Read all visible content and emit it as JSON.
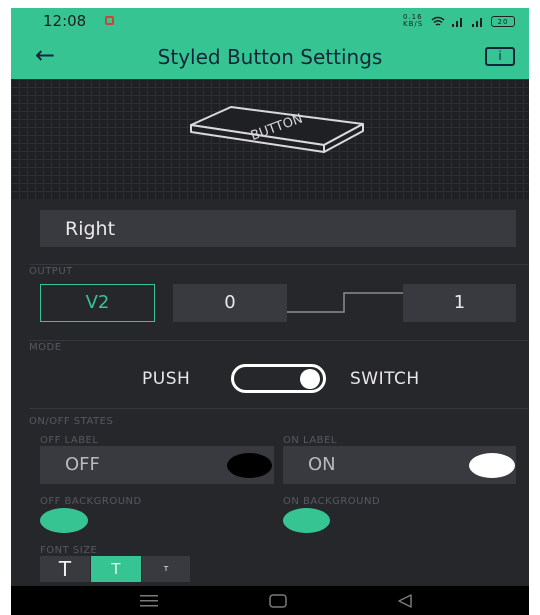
{
  "status_bar": {
    "time": "12:08",
    "right_text": "0.16 KB/S",
    "battery": "20"
  },
  "header": {
    "title": "Styled Button Settings"
  },
  "preview": {
    "button_text": "BUTTON"
  },
  "name_field": {
    "value": "Right"
  },
  "output": {
    "section_label": "OUTPUT",
    "pin": "V2",
    "min_value": "0",
    "max_value": "1"
  },
  "mode": {
    "section_label": "MODE",
    "push_label": "PUSH",
    "switch_label": "SWITCH",
    "selected": "SWITCH"
  },
  "states": {
    "section_label": "ON/OFF STATES",
    "off_label_title": "OFF LABEL",
    "off_label_value": "OFF",
    "off_label_color": "#000000",
    "on_label_title": "ON LABEL",
    "on_label_value": "ON",
    "on_label_color": "#ffffff",
    "off_background_title": "OFF BACKGROUND",
    "off_background_color": "#36c592",
    "on_background_title": "ON BACKGROUND",
    "on_background_color": "#36c592"
  },
  "font_size": {
    "section_label": "FONT SIZE",
    "options": [
      "T",
      "T",
      "T"
    ],
    "selected_index": 1
  },
  "colors": {
    "accent": "#36c592",
    "background": "#26272b",
    "field": "#393a3f"
  },
  "nav_bar": {
    "icons": [
      "menu-icon",
      "home-icon",
      "back-icon"
    ]
  }
}
